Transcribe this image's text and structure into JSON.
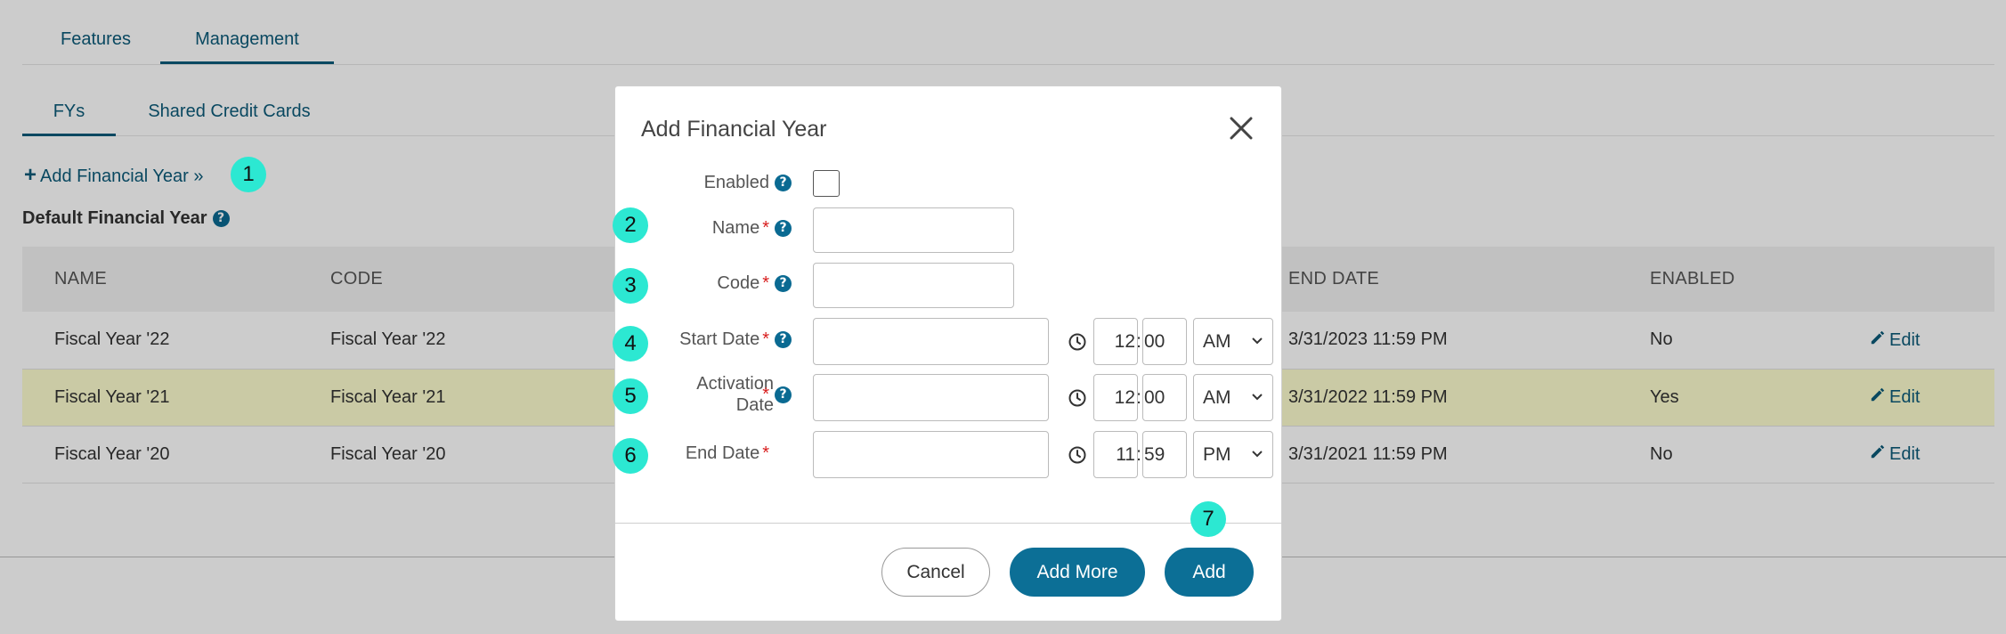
{
  "tabs": [
    {
      "label": "Features",
      "active": false
    },
    {
      "label": "Management",
      "active": true
    }
  ],
  "subtabs": [
    {
      "label": "FYs",
      "active": true
    },
    {
      "label": "Shared Credit Cards",
      "active": false
    }
  ],
  "actions": {
    "add_fy_plus": "+",
    "add_fy_label": "Add Financial Year »"
  },
  "default_fy": {
    "label": "Default Financial Year",
    "help": "?"
  },
  "table": {
    "headers": [
      "NAME",
      "CODE",
      "END DATE",
      "ENABLED"
    ],
    "rows": [
      {
        "name": "Fiscal Year '22",
        "code": "Fiscal Year '22",
        "end_date": "3/31/2023 11:59 PM",
        "enabled": "No",
        "edit": "Edit",
        "highlight": false
      },
      {
        "name": "Fiscal Year '21",
        "code": "Fiscal Year '21",
        "end_date": "3/31/2022 11:59 PM",
        "enabled": "Yes",
        "edit": "Edit",
        "highlight": true
      },
      {
        "name": "Fiscal Year '20",
        "code": "Fiscal Year '20",
        "end_date": "3/31/2021 11:59 PM",
        "enabled": "No",
        "edit": "Edit",
        "highlight": false
      }
    ]
  },
  "modal": {
    "title": "Add Financial Year",
    "close_icon": "close-icon",
    "help": "?",
    "required_mark": "*",
    "fields": {
      "enabled": {
        "label": "Enabled"
      },
      "name": {
        "label": "Name",
        "value": ""
      },
      "code": {
        "label": "Code",
        "value": ""
      },
      "start_date": {
        "label": "Start Date",
        "value": "",
        "hour": "12",
        "minute": "00",
        "ampm": "AM"
      },
      "activation_date": {
        "label_line1": "Activation",
        "label_line2": "Date",
        "value": "",
        "hour": "12",
        "minute": "00",
        "ampm": "AM"
      },
      "end_date": {
        "label": "End Date",
        "value": "",
        "hour": "11",
        "minute": "59",
        "ampm": "PM"
      }
    },
    "buttons": {
      "cancel": "Cancel",
      "add_more": "Add More",
      "add": "Add"
    }
  },
  "markers": [
    "1",
    "2",
    "3",
    "4",
    "5",
    "6",
    "7"
  ],
  "colors": {
    "link": "#0c5a79",
    "primary": "#0c6f96",
    "marker": "#2ce8d2",
    "highlight_row": "#fdfdcf",
    "required": "#d81d1d"
  }
}
